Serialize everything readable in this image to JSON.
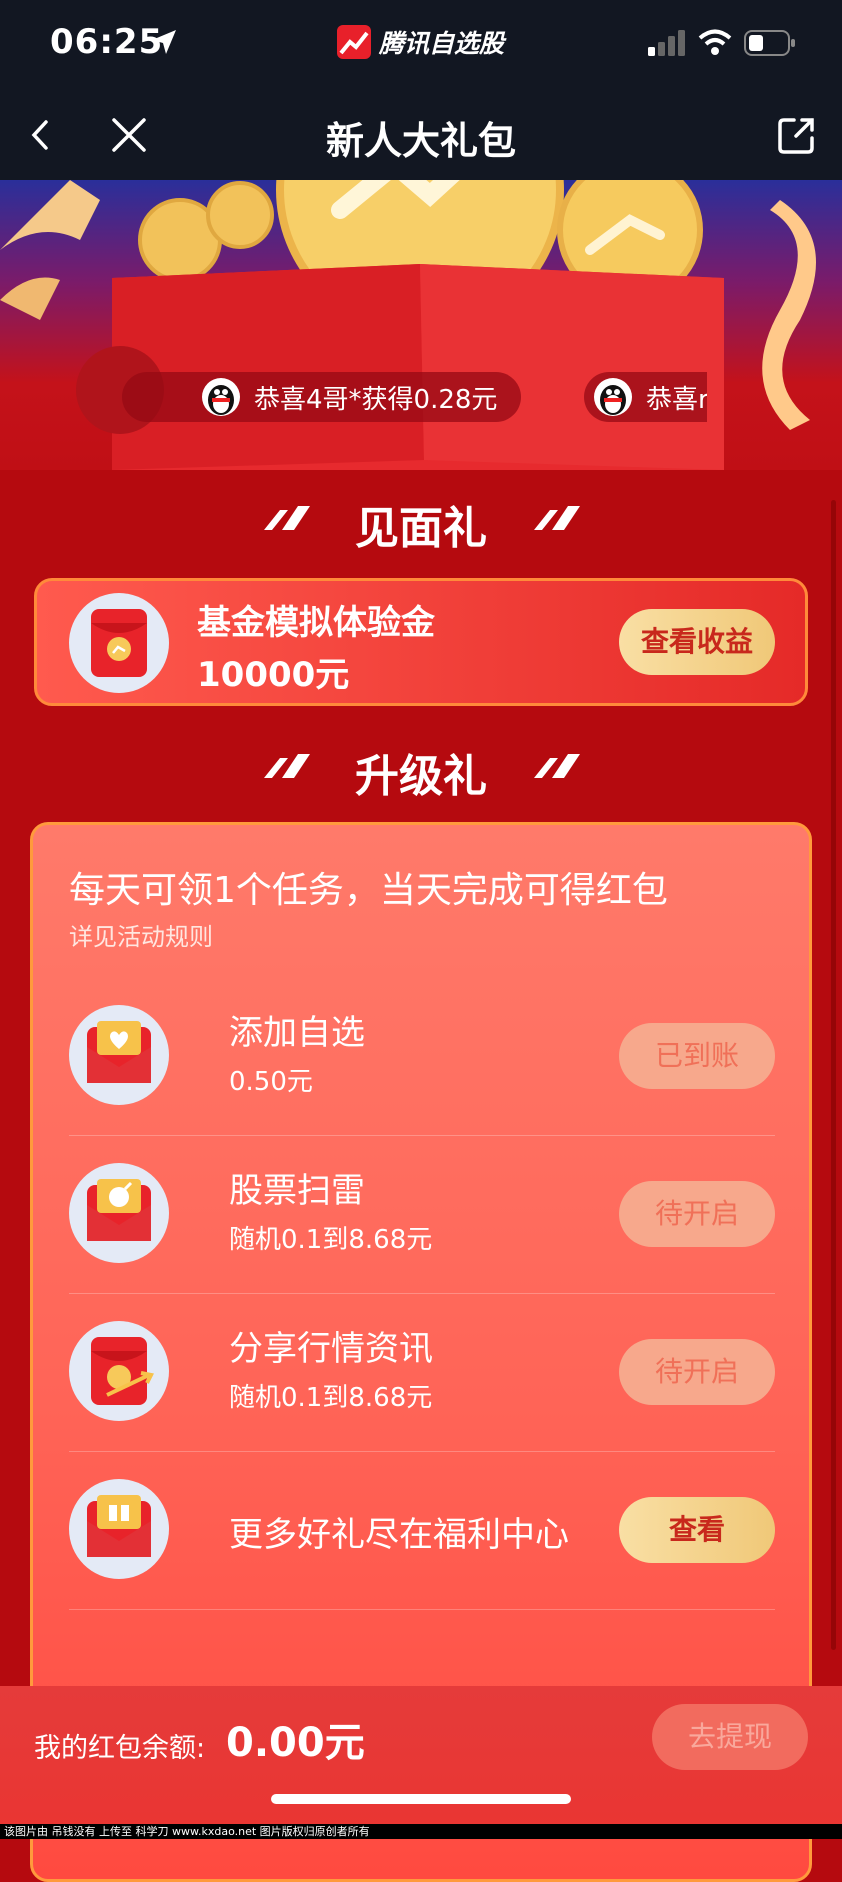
{
  "status_bar": {
    "time": "06:25",
    "app_name": "腾讯自选股"
  },
  "nav": {
    "title": "新人大礼包"
  },
  "ticker": {
    "items": [
      "恭喜4哥*获得0.28元",
      "恭喜rc"
    ]
  },
  "welcome": {
    "section_title": "见面礼",
    "gift_title": "基金模拟体验金",
    "gift_amount": "10000元",
    "button_label": "查看收益"
  },
  "upgrade": {
    "section_title": "升级礼",
    "headline": "每天可领1个任务，当天完成可得红包",
    "rules_link": "详见活动规则",
    "tasks": [
      {
        "name": "添加自选",
        "reward": "0.50元",
        "button": "已到账",
        "icon": "heart-envelope-icon"
      },
      {
        "name": "股票扫雷",
        "reward": "随机0.1到8.68元",
        "button": "待开启",
        "icon": "bomb-envelope-icon"
      },
      {
        "name": "分享行情资讯",
        "reward": "随机0.1到8.68元",
        "button": "待开启",
        "icon": "share-envelope-icon"
      },
      {
        "name": "更多好礼尽在福利中心",
        "reward": "",
        "button": "查看",
        "icon": "gift-envelope-icon"
      }
    ]
  },
  "bottom": {
    "balance_label": "我的红包余额:",
    "balance_value": "0.00元",
    "withdraw_label": "去提现"
  },
  "footer": {
    "note": "该图片由 吊钱没有 上传至 科学刀 www.kxdao.net 图片版权归原创者所有"
  },
  "colors": {
    "primary_red": "#c00f15",
    "gold": "#f0c878",
    "nav_bg": "#121722"
  }
}
